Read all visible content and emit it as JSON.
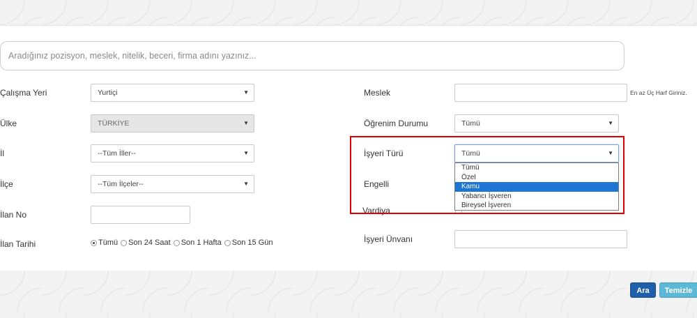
{
  "search": {
    "placeholder": "Aradığınız pozisyon, meslek, nitelik, beceri, firma adını yazınız..."
  },
  "left": {
    "calisma_yeri": {
      "label": "Çalışma Yeri",
      "value": "Yurtiçi"
    },
    "ulke": {
      "label": "Ülke",
      "value": "TÜRKİYE"
    },
    "il": {
      "label": "İl",
      "value": "--Tüm İller--"
    },
    "ilce": {
      "label": "İlçe",
      "value": "--Tüm İlçeler--"
    },
    "ilan_no": {
      "label": "İlan No",
      "value": ""
    },
    "ilan_tarihi": {
      "label": "İlan Tarihi",
      "options": [
        "Tümü",
        "Son 24 Saat",
        "Son 1 Hafta",
        "Son 15 Gün"
      ],
      "selected": "Tümü"
    }
  },
  "right": {
    "meslek": {
      "label": "Meslek",
      "value": "",
      "hint": "En az Üç Harf Giriniz."
    },
    "ogrenim_durumu": {
      "label": "Öğrenim Durumu",
      "value": "Tümü"
    },
    "isyeri_turu": {
      "label": "İşyeri Türü",
      "value": "Tümü",
      "options": [
        "Tümü",
        "Özel",
        "Kamu",
        "Yabancı İşveren",
        "Bireysel İşveren"
      ],
      "highlighted": "Kamu"
    },
    "engelli": {
      "label": "Engelli"
    },
    "vardiya": {
      "label": "Vardiya"
    },
    "isyeri_unvani": {
      "label": "İşyeri Ünvanı",
      "value": ""
    }
  },
  "buttons": {
    "ara": "Ara",
    "temizle": "Temizle"
  },
  "icons": {
    "caret": "▼"
  },
  "colors": {
    "primary_button": "#1f5ea8",
    "info_button": "#5db8d6",
    "highlight_border": "#e00000",
    "dropdown_highlight": "#1e76d2"
  }
}
